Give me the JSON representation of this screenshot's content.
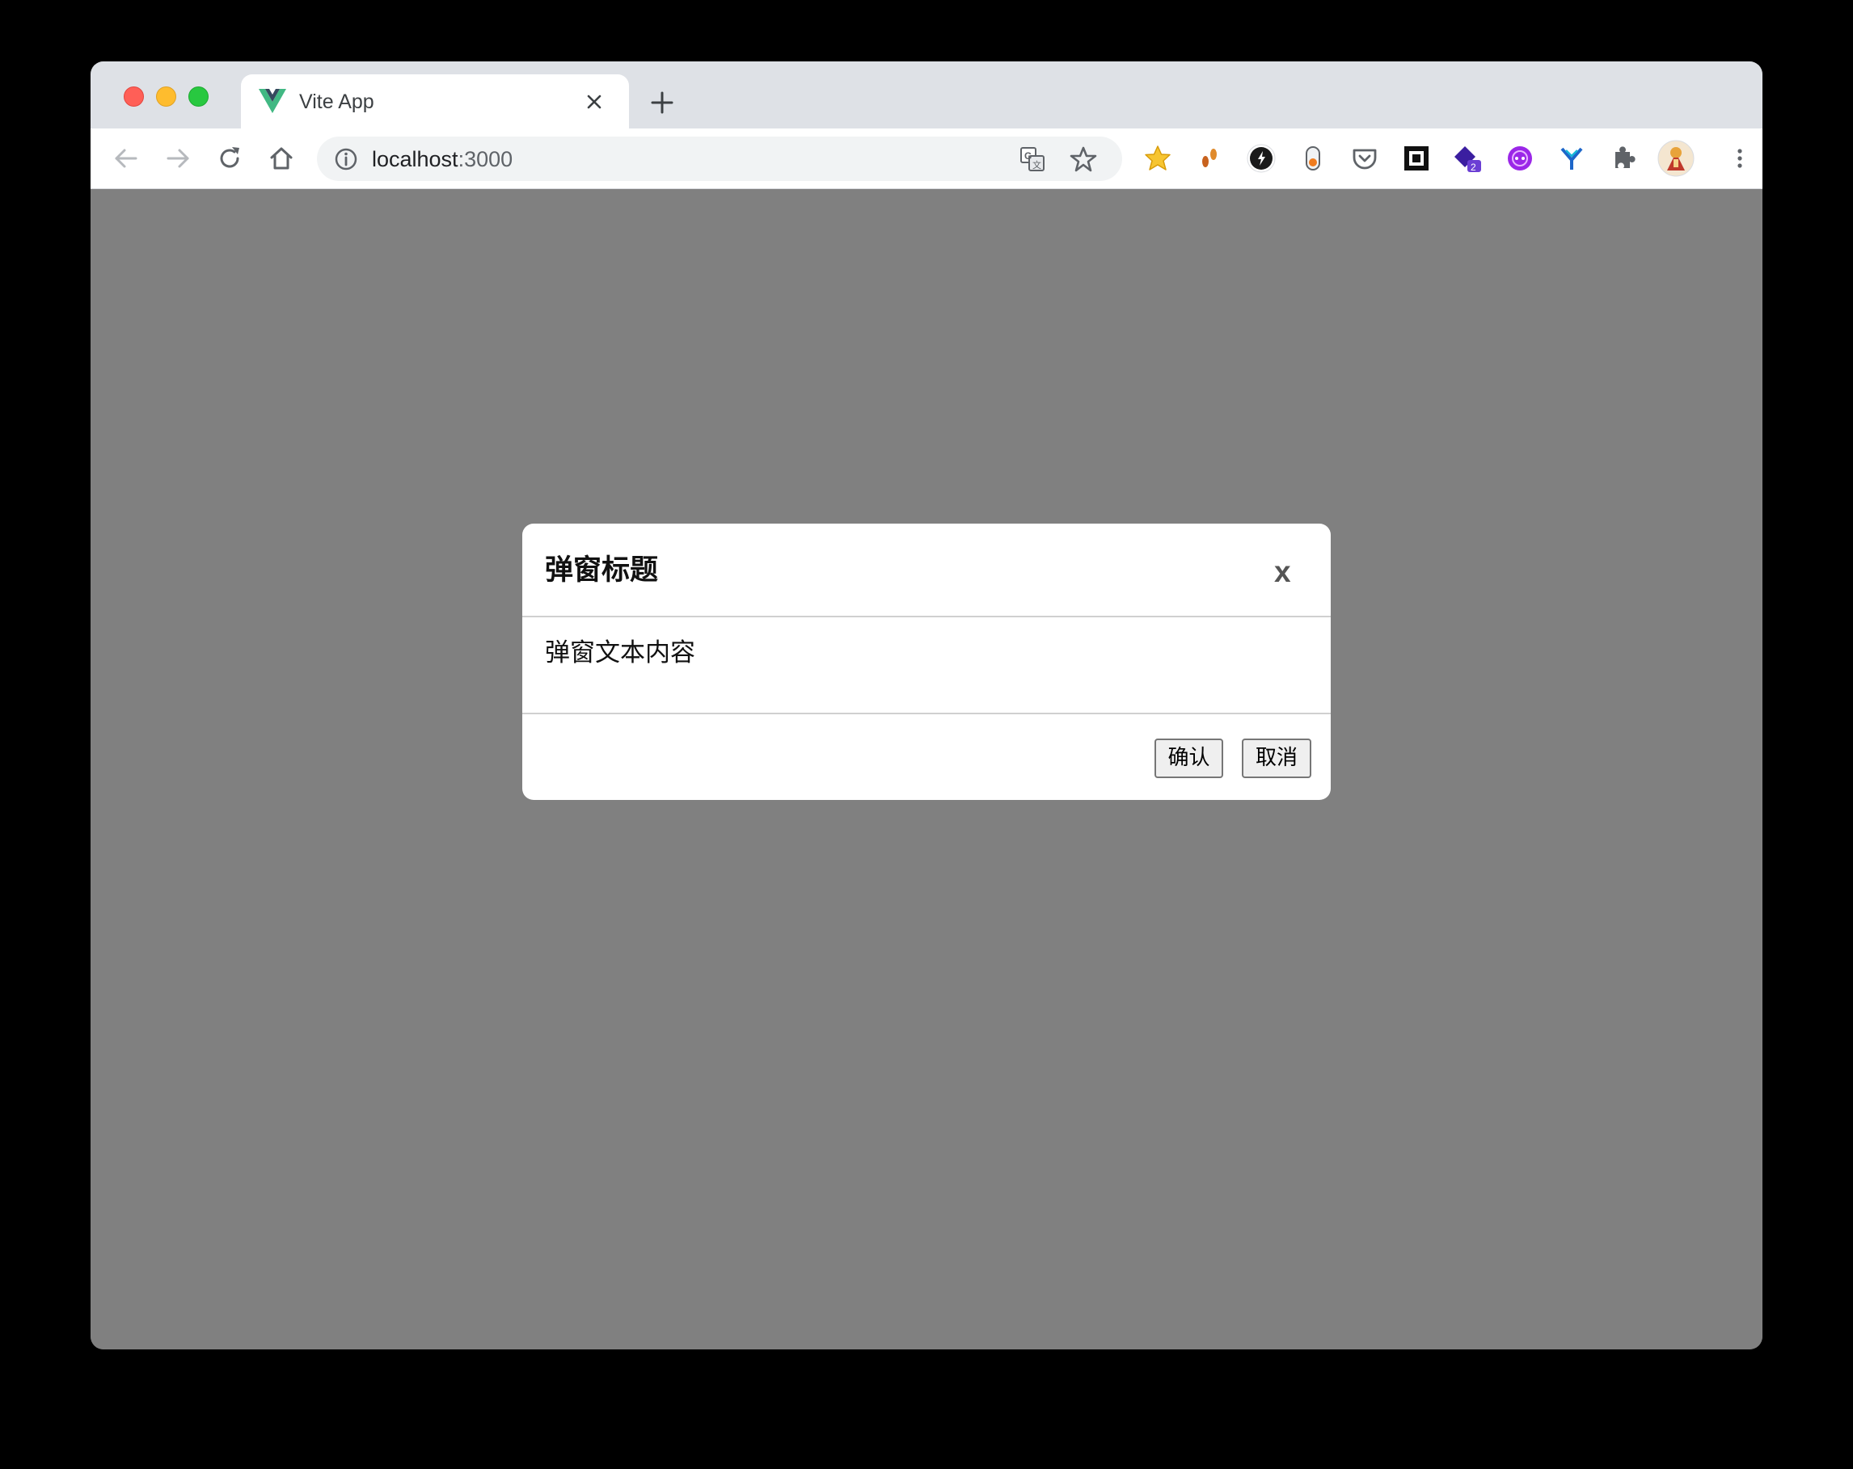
{
  "browser": {
    "tab": {
      "title": "Vite App",
      "favicon": "vue-logo-icon"
    },
    "address": {
      "host": "localhost",
      "port": ":3000"
    },
    "extensions": [
      "star-extension-icon",
      "footprints-extension-icon",
      "dark-circle-extension-icon",
      "toggle-extension-icon",
      "pocket-icon",
      "square-extension-icon",
      "purple-extension-icon",
      "magenta-extension-icon",
      "y-extension-icon",
      "puzzle-icon",
      "profile-avatar",
      "more-vert-icon"
    ],
    "extension_badge": "2",
    "colors": {
      "chrome_bg": "#dee1e6",
      "page_bg": "#808080"
    }
  },
  "modal": {
    "title": "弹窗标题",
    "close_label": "x",
    "body_text": "弹窗文本内容",
    "confirm_label": "确认",
    "cancel_label": "取消"
  }
}
